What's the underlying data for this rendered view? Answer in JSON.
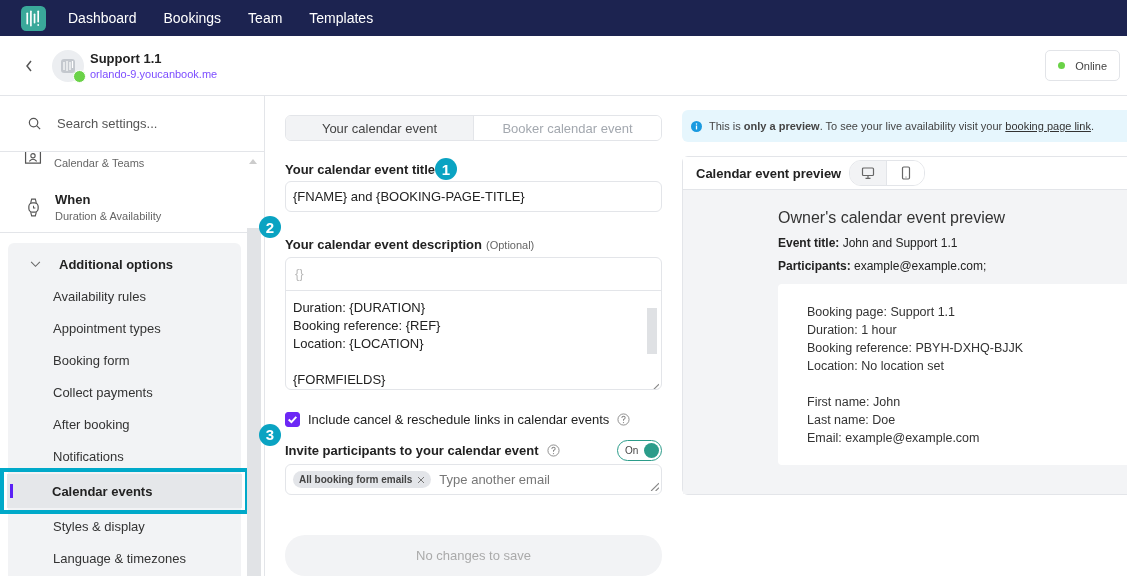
{
  "nav": {
    "items": [
      {
        "label": "Dashboard"
      },
      {
        "label": "Bookings"
      },
      {
        "label": "Team"
      },
      {
        "label": "Templates"
      }
    ]
  },
  "header": {
    "title": "Support 1.1",
    "url": "orlando-9.youcanbook.me",
    "online": true,
    "status": "Online"
  },
  "sidebar": {
    "search_placeholder": "Search settings...",
    "sections": [
      {
        "subtitle": "Calendar & Teams"
      },
      {
        "title": "When",
        "subtitle": "Duration & Availability"
      }
    ],
    "group": {
      "title": "Additional options",
      "expanded": true,
      "items": [
        {
          "label": "Availability rules",
          "selected": false,
          "annotated": false
        },
        {
          "label": "Appointment types",
          "selected": false,
          "annotated": false
        },
        {
          "label": "Booking form",
          "selected": false,
          "annotated": false
        },
        {
          "label": "Collect payments",
          "selected": false,
          "annotated": false
        },
        {
          "label": "After booking",
          "selected": false,
          "annotated": false
        },
        {
          "label": "Notifications",
          "selected": false,
          "annotated": false
        },
        {
          "label": "Calendar events",
          "selected": true,
          "annotated": true
        },
        {
          "label": "Styles & display",
          "selected": false,
          "annotated": false
        },
        {
          "label": "Language & timezones",
          "selected": false,
          "annotated": false
        }
      ]
    }
  },
  "form": {
    "tabs": [
      {
        "label": "Your calendar event",
        "selected": true
      },
      {
        "label": "Booker calendar event",
        "selected": false
      }
    ],
    "title_field": {
      "label": "Your calendar event title",
      "marker": "1",
      "value": "{FNAME} and {BOOKING-PAGE-TITLE}"
    },
    "description": {
      "label": "Your calendar event description",
      "hint": "(Optional)",
      "marker": "2",
      "toolbar": "{}",
      "paragraphs": [
        [
          "Duration: {DURATION}",
          "Booking reference: {REF}",
          "Location: {LOCATION}"
        ],
        [
          "{FORMFIELDS}"
        ]
      ]
    },
    "checkbox": {
      "label": "Include cancel & reschedule links in calendar events",
      "checked": true
    },
    "invite": {
      "label": "Invite participants to your calendar event",
      "marker": "3",
      "on": true,
      "toggle_label": "On",
      "chips": [
        {
          "label": "All booking form emails"
        }
      ],
      "placeholder": "Type another email"
    },
    "save_button": {
      "label": "No changes to save",
      "disabled": true
    }
  },
  "preview": {
    "notice": "This is **only a preview**. To see your live availability visit your ",
    "link": "booking page link",
    "notice_end": ".",
    "card_title": "Calendar event preview",
    "heading": "Owner's calendar event preview",
    "fields": [
      "**Event title:** John and Support 1.1",
      "**Participants:** example@example.com;"
    ],
    "paragraphs": [
      [
        "Booking page: Support 1.1",
        "Duration: 1 hour",
        "Booking reference: PBYH-DXHQ-BJJK",
        "Location: No location set"
      ],
      [
        "First name: John",
        "Last name: Doe",
        "Email: example@example.com"
      ]
    ]
  }
}
